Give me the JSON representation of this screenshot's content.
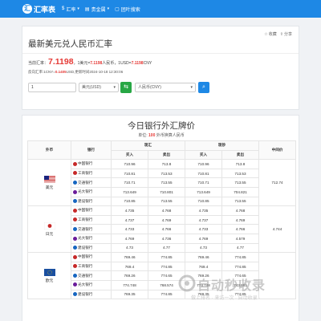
{
  "topbar": {
    "logo_text": "汇率表",
    "logo_mark": "汇",
    "nav": [
      {
        "label": "汇率",
        "icon": "dollar-icon",
        "icon_glyph": "$"
      },
      {
        "label": "贵金属",
        "icon": "bars-icon",
        "icon_glyph": "▤"
      },
      {
        "label": "团叶搜索",
        "icon": "doc-icon",
        "icon_glyph": "▢"
      }
    ]
  },
  "converter": {
    "title": "最新美元兑人民币汇率",
    "bookmark": "收藏",
    "share": "分享",
    "rate_prefix": "当前汇率：",
    "rate_big": "7.1198",
    "rate_mid1": "，1美元=",
    "rate_red1": "7.1198",
    "rate_mid2": "人民币，1USD=",
    "rate_red2": "7.1198",
    "rate_suffix": "CNY",
    "reverse_prefix": "反向汇率:1CNY=",
    "reverse_red": "0.1405",
    "reverse_suffix": "USD,更新时间2024-10-18 12:30:06",
    "amount": "1",
    "from_currency": "美元(USD)",
    "to_currency": "人民币(CNY)",
    "swap_glyph": "⇆",
    "search_glyph": "⌕"
  },
  "board": {
    "title": "今日银行外汇牌价",
    "sub_prefix": "单位: ",
    "sub_red": "100",
    "sub_suffix": " 外币换算人民币",
    "headers": {
      "currency": "外币",
      "bank": "银行",
      "spot": "现汇",
      "cash": "现钞",
      "middle": "中间价",
      "buy": "买入",
      "sell": "卖出"
    },
    "groups": [
      {
        "currency": "美元",
        "flag": "us",
        "middle": "712.74",
        "rows": [
          {
            "bank": "中国银行",
            "color": "#c62828",
            "spot_buy": "710.96",
            "spot_sell": "713.8",
            "cash_buy": "710.96",
            "cash_sell": "713.8"
          },
          {
            "bank": "工商银行",
            "color": "#c62828",
            "spot_buy": "710.81",
            "spot_sell": "713.53",
            "cash_buy": "710.81",
            "cash_sell": "713.53"
          },
          {
            "bank": "交通银行",
            "color": "#1565c0",
            "spot_buy": "710.71",
            "spot_sell": "713.55",
            "cash_buy": "710.71",
            "cash_sell": "713.55"
          },
          {
            "bank": "光大银行",
            "color": "#6a1b9a",
            "spot_buy": "713.649",
            "spot_sell": "710.801",
            "cash_buy": "713.649",
            "cash_sell": "704.821"
          },
          {
            "bank": "建设银行",
            "color": "#1565c0",
            "spot_buy": "710.85",
            "spot_sell": "713.55",
            "cash_buy": "710.85",
            "cash_sell": "713.55"
          }
        ]
      },
      {
        "currency": "日元",
        "flag": "jp",
        "middle": "4.744",
        "rows": [
          {
            "bank": "中国银行",
            "color": "#c62828",
            "spot_buy": "4.735",
            "spot_sell": "4.768",
            "cash_buy": "4.735",
            "cash_sell": "4.768"
          },
          {
            "bank": "工商银行",
            "color": "#c62828",
            "spot_buy": "4.737",
            "spot_sell": "4.769",
            "cash_buy": "4.737",
            "cash_sell": "4.769"
          },
          {
            "bank": "交通银行",
            "color": "#1565c0",
            "spot_buy": "4.733",
            "spot_sell": "4.766",
            "cash_buy": "4.733",
            "cash_sell": "4.766"
          },
          {
            "bank": "光大银行",
            "color": "#6a1b9a",
            "spot_buy": "4.769",
            "spot_sell": "4.736",
            "cash_buy": "4.769",
            "cash_sell": "4.579"
          },
          {
            "bank": "建设银行",
            "color": "#1565c0",
            "spot_buy": "4.73",
            "spot_sell": "4.77",
            "cash_buy": "4.73",
            "cash_sell": "4.77"
          }
        ]
      },
      {
        "currency": "欧元",
        "flag": "eu",
        "middle": "",
        "rows": [
          {
            "bank": "中国银行",
            "color": "#c62828",
            "spot_buy": "769.46",
            "spot_sell": "774.85",
            "cash_buy": "769.46",
            "cash_sell": "774.85"
          },
          {
            "bank": "工商银行",
            "color": "#c62828",
            "spot_buy": "769.4",
            "spot_sell": "774.85",
            "cash_buy": "769.4",
            "cash_sell": "774.85"
          },
          {
            "bank": "交通银行",
            "color": "#1565c0",
            "spot_buy": "769.26",
            "spot_sell": "774.65",
            "cash_buy": "769.26",
            "cash_sell": "774.65"
          },
          {
            "bank": "光大银行",
            "color": "#6a1b9a",
            "spot_buy": "774.748",
            "spot_sell": "768.574",
            "cash_buy": "774.748",
            "cash_sell": "743.881"
          },
          {
            "bank": "建设银行",
            "color": "#1565c0",
            "spot_buy": "769.35",
            "spot_sell": "774.85",
            "cash_buy": "769.35",
            "cash_sell": "774.85"
          }
        ]
      }
    ]
  },
  "watermark": {
    "title": "自动秒收录",
    "subtitle": "做上排名 · 来访一次 · 自动收录 ·"
  },
  "colors": {
    "brand": "#1e88e5",
    "accent_red": "#e53935",
    "swap_green": "#28a745"
  }
}
